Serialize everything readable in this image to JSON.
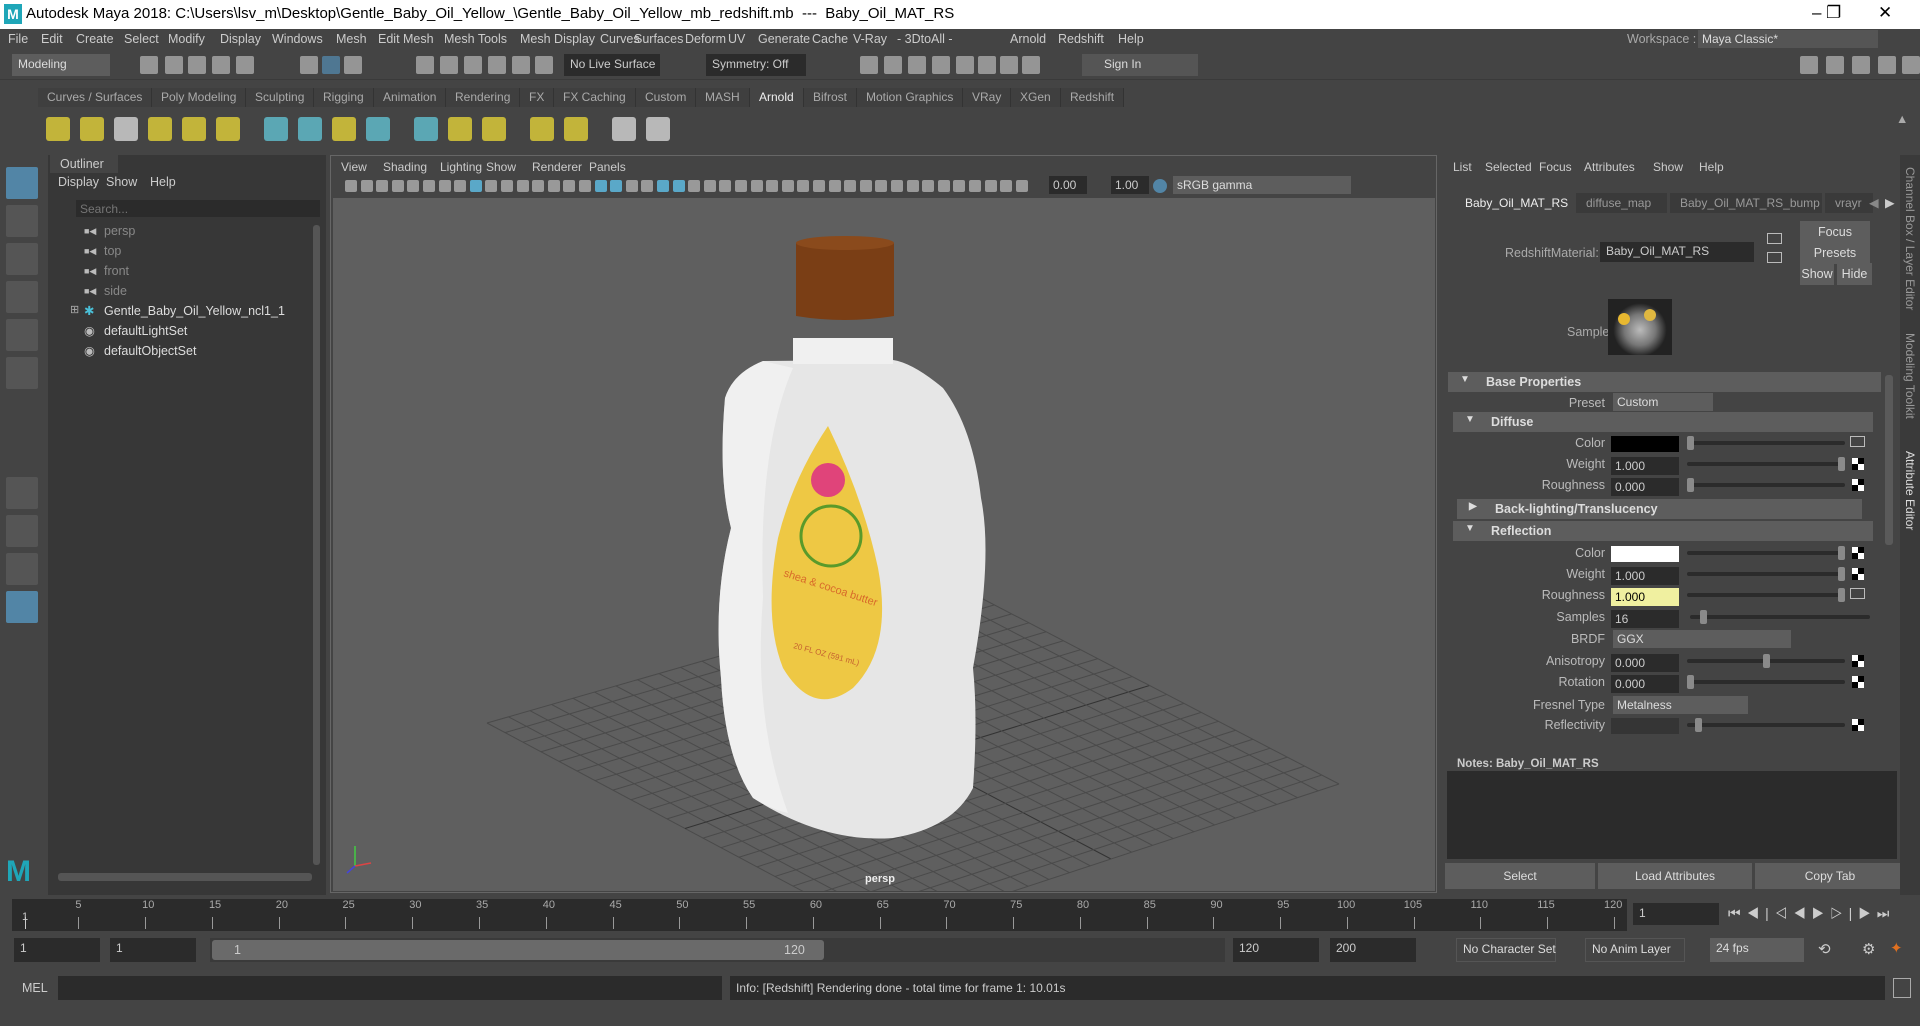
{
  "title": {
    "app_title": "Autodesk Maya 2018: C:\\Users\\lsv_m\\Desktop\\Gentle_Baby_Oil_Yellow_\\Gentle_Baby_Oil_Yellow_mb_redshift.mb  ---  Baby_Oil_MAT_RS",
    "minimize": "–",
    "maximize": "❐",
    "close": "✕"
  },
  "menu": [
    "File",
    "Edit",
    "Create",
    "Select",
    "Modify",
    "Display",
    "Windows",
    "Mesh",
    "Edit Mesh",
    "Mesh Tools",
    "Mesh Display",
    "Curves",
    "Surfaces",
    "Deform",
    "UV",
    "Generate",
    "Cache",
    "V-Ray",
    "- 3DtoAll -",
    "Arnold",
    "Redshift",
    "Help"
  ],
  "workspace": {
    "label": "Workspace :",
    "value": "Maya Classic*"
  },
  "statusline": {
    "mode": "Modeling",
    "live_surface": "No Live Surface",
    "symmetry": "Symmetry: Off",
    "sign_in": "Sign In"
  },
  "shelf_tabs": [
    "Curves / Surfaces",
    "Poly Modeling",
    "Sculpting",
    "Rigging",
    "Animation",
    "Rendering",
    "FX",
    "FX Caching",
    "Custom",
    "MASH",
    "Arnold",
    "Bifrost",
    "Motion Graphics",
    "VRay",
    "XGen",
    "Redshift"
  ],
  "shelf_active": "Arnold",
  "outliner": {
    "tab": "Outliner",
    "menu": [
      "Display",
      "Show",
      "Help"
    ],
    "search_placeholder": "Search...",
    "items": [
      {
        "label": "persp",
        "icon": "camera-icon",
        "dim": true
      },
      {
        "label": "top",
        "icon": "camera-icon",
        "dim": true
      },
      {
        "label": "front",
        "icon": "camera-icon",
        "dim": true
      },
      {
        "label": "side",
        "icon": "camera-icon",
        "dim": true
      },
      {
        "label": "Gentle_Baby_Oil_Yellow_ncl1_1",
        "icon": "group-icon",
        "expand": "+"
      },
      {
        "label": "defaultLightSet",
        "icon": "set-icon"
      },
      {
        "label": "defaultObjectSet",
        "icon": "set-icon"
      }
    ]
  },
  "viewport": {
    "menu": [
      "View",
      "Shading",
      "Lighting",
      "Show",
      "Renderer",
      "Panels"
    ],
    "exposure": "0.00",
    "gamma": "1.00",
    "color_space": "sRGB gamma",
    "camera": "persp",
    "label_main": "shea & cocoa butter",
    "label_size": "20 FL OZ (591 mL)"
  },
  "ae": {
    "menu": [
      "List",
      "Selected",
      "Focus",
      "Attributes",
      "Show",
      "Help"
    ],
    "tabs": [
      "Baby_Oil_MAT_RS",
      "diffuse_map",
      "Baby_Oil_MAT_RS_bump",
      "vrayr"
    ],
    "type_label": "RedshiftMaterial:",
    "name": "Baby_Oil_MAT_RS",
    "buttons": {
      "focus": "Focus",
      "presets": "Presets",
      "show": "Show",
      "hide": "Hide"
    },
    "sample_label": "Sample",
    "base_properties": "Base Properties",
    "preset_label": "Preset",
    "preset_value": "Custom",
    "diffuse": {
      "title": "Diffuse",
      "color_label": "Color",
      "color": "#000000",
      "weight_label": "Weight",
      "weight": "1.000",
      "weight_frac": 1.0,
      "roughness_label": "Roughness",
      "roughness": "0.000",
      "roughness_frac": 0.0
    },
    "backlighting": "Back-lighting/Translucency",
    "reflection": {
      "title": "Reflection",
      "color_label": "Color",
      "color": "#ffffff",
      "weight_label": "Weight",
      "weight": "1.000",
      "weight_frac": 1.0,
      "roughness_label": "Roughness",
      "roughness": "1.000",
      "roughness_frac": 1.0,
      "samples_label": "Samples",
      "samples": "16",
      "samples_frac": 0.06,
      "brdf_label": "BRDF",
      "brdf": "GGX",
      "anisotropy_label": "Anisotropy",
      "anisotropy": "0.000",
      "anisotropy_frac": 0.5,
      "rotation_label": "Rotation",
      "rotation": "0.000",
      "rotation_frac": 0.0,
      "fresnel_label": "Fresnel Type",
      "fresnel": "Metalness",
      "reflectivity_label": "Reflectivity",
      "reflectivity_frac": 0.05
    },
    "notes_label": "Notes:  Baby_Oil_MAT_RS",
    "bottom_buttons": [
      "Select",
      "Load Attributes",
      "Copy Tab"
    ]
  },
  "side_tabs": [
    "Channel Box / Layer Editor",
    "Modeling Toolkit",
    "Attribute Editor"
  ],
  "timeline": {
    "start": 1,
    "end": 120,
    "current": "1",
    "labels": [
      5,
      10,
      15,
      20,
      25,
      30,
      35,
      40,
      45,
      50,
      55,
      60,
      65,
      70,
      75,
      80,
      85,
      90,
      95,
      100,
      105,
      110,
      115,
      120
    ]
  },
  "range": {
    "start": "1",
    "playback_start": "1",
    "slider_start": "1",
    "slider_end": "120",
    "playback_end": "120",
    "end": "200",
    "character_set": "No Character Set",
    "anim_layer": "No Anim Layer",
    "fps": "24 fps"
  },
  "command": {
    "lang": "MEL",
    "info": "Info:  [Redshift] Rendering done - total time for frame 1: 10.01s"
  },
  "colors": {
    "accent": "#5285a6",
    "highlight_field": "#f0f0a0",
    "active_tool": "#5285a6"
  }
}
